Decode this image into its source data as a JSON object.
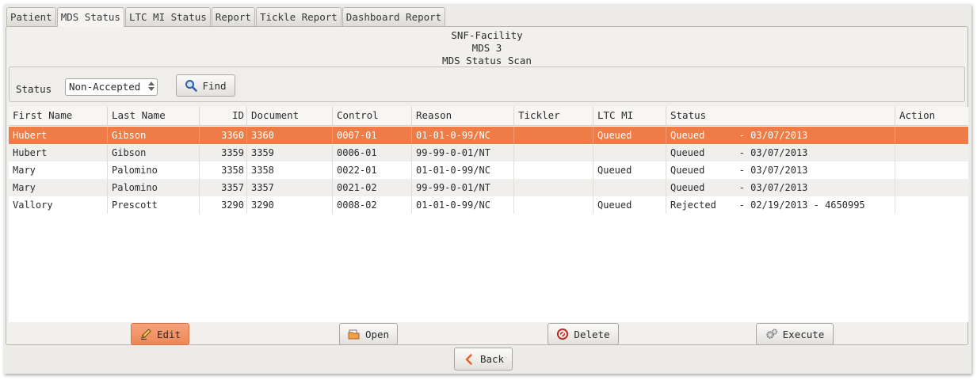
{
  "tabs": [
    "Patient",
    "MDS Status",
    "LTC MI Status",
    "Report",
    "Tickle Report",
    "Dashboard Report"
  ],
  "active_tab": 1,
  "header": {
    "facility": "SNF-Facility",
    "subtitle": "MDS 3",
    "title": "MDS Status Scan"
  },
  "filter": {
    "status_label": "Status",
    "status_value": "Non-Accepted",
    "find_label": "Find"
  },
  "columns": [
    "First Name",
    "Last Name",
    "ID",
    "Document",
    "Control",
    "Reason",
    "Tickler",
    "LTC MI",
    "Status",
    "Action"
  ],
  "rows": [
    {
      "first": "Hubert",
      "last": "Gibson",
      "id": "3360",
      "document": "3360",
      "control": "0007-01",
      "reason": "01-01-0-99/NC",
      "tickler": "",
      "ltcmi": "Queued",
      "status": "Queued      - 03/07/2013",
      "action": "",
      "selected": true
    },
    {
      "first": "Hubert",
      "last": "Gibson",
      "id": "3359",
      "document": "3359",
      "control": "0006-01",
      "reason": "99-99-0-01/NT",
      "tickler": "",
      "ltcmi": "",
      "status": "Queued      - 03/07/2013",
      "action": ""
    },
    {
      "first": "Mary",
      "last": "Palomino",
      "id": "3358",
      "document": "3358",
      "control": "0022-01",
      "reason": "01-01-0-99/NC",
      "tickler": "",
      "ltcmi": "Queued",
      "status": "Queued      - 03/07/2013",
      "action": ""
    },
    {
      "first": "Mary",
      "last": "Palomino",
      "id": "3357",
      "document": "3357",
      "control": "0021-02",
      "reason": "99-99-0-01/NT",
      "tickler": "",
      "ltcmi": "",
      "status": "Queued      - 03/07/2013",
      "action": ""
    },
    {
      "first": "Vallory",
      "last": "Prescott",
      "id": "3290",
      "document": "3290",
      "control": "0008-02",
      "reason": "01-01-0-99/NC",
      "tickler": "",
      "ltcmi": "Queued",
      "status": "Rejected    - 02/19/2013 - 4650995",
      "action": ""
    }
  ],
  "actions": {
    "edit": "Edit",
    "open": "Open",
    "delete": "Delete",
    "execute": "Execute",
    "back": "Back"
  },
  "icons": {
    "find": "magnifier-icon",
    "edit": "pencil-icon",
    "open": "folder-icon",
    "delete": "no-entry-icon",
    "execute": "gears-icon",
    "back": "chevron-left-icon"
  },
  "colors": {
    "selected_row": "#ef7c47",
    "edit_button": "#f29466",
    "delete_icon": "#d83a2e"
  }
}
